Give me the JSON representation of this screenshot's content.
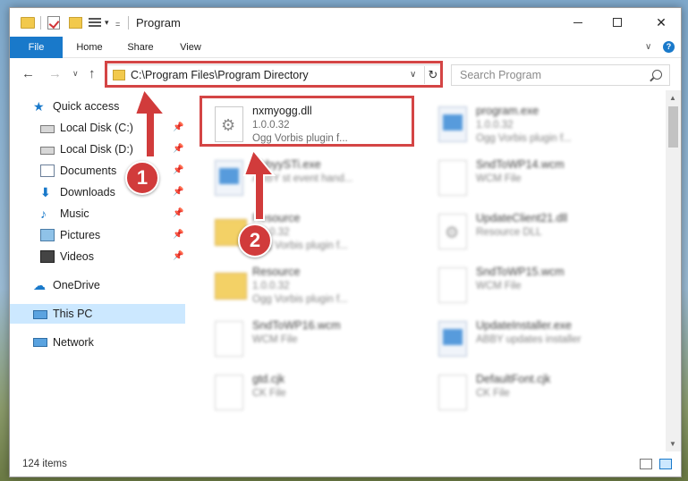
{
  "window": {
    "title": "Program",
    "controls": {
      "minimize": "minimize",
      "maximize": "maximize",
      "close": "✕"
    }
  },
  "ribbon": {
    "tabs": [
      "File",
      "Home",
      "Share",
      "View"
    ],
    "expand": "∨",
    "help": "?"
  },
  "nav": {
    "back": "←",
    "forward": "→",
    "recent": "∨",
    "up": "↑",
    "address": "C:\\Program Files\\Program Directory",
    "address_dropdown": "∨",
    "refresh": "↻",
    "search_placeholder": "Search Program"
  },
  "sidebar": {
    "items": [
      {
        "label": "Quick access",
        "icon": "star-icon",
        "pinned": false
      },
      {
        "label": "Local Disk (C:)",
        "icon": "disk-icon",
        "pinned": true
      },
      {
        "label": "Local Disk (D:)",
        "icon": "disk-icon",
        "pinned": true
      },
      {
        "label": "Documents",
        "icon": "documents-icon",
        "pinned": true
      },
      {
        "label": "Downloads",
        "icon": "download-icon",
        "pinned": true
      },
      {
        "label": "Music",
        "icon": "music-icon",
        "pinned": true
      },
      {
        "label": "Pictures",
        "icon": "pictures-icon",
        "pinned": true
      },
      {
        "label": "Videos",
        "icon": "videos-icon",
        "pinned": true
      },
      {
        "label": "OneDrive",
        "icon": "cloud-icon",
        "pinned": false
      },
      {
        "label": "This PC",
        "icon": "pc-icon",
        "pinned": false,
        "selected": true
      },
      {
        "label": "Network",
        "icon": "network-icon",
        "pinned": false
      }
    ],
    "pin_glyph": "📌"
  },
  "files": [
    {
      "name": "nxmyogg.dll",
      "line2": "1.0.0.32",
      "line3": "Ogg Vorbis plugin f...",
      "icon": "dll",
      "blurred": false
    },
    {
      "name": "program.exe",
      "line2": "1.0.0.32",
      "line3": "Ogg Vorbis plugin f...",
      "icon": "exe",
      "blurred": true
    },
    {
      "name": "AbbyySTi.exe",
      "line2": "ABBY st event hand...",
      "line3": "",
      "icon": "exe",
      "blurred": true
    },
    {
      "name": "SndToWP14.wcm",
      "line2": "WCM File",
      "line3": "",
      "icon": "doc",
      "blurred": true
    },
    {
      "name": "Resource",
      "line2": "1.0.0.32",
      "line3": "Ogg Vorbis plugin f...",
      "icon": "folder",
      "blurred": true
    },
    {
      "name": "UpdateClient21.dll",
      "line2": "Resource DLL",
      "line3": "",
      "icon": "dll",
      "blurred": true
    },
    {
      "name": "Resource",
      "line2": "1.0.0.32",
      "line3": "Ogg Vorbis plugin f...",
      "icon": "folder",
      "blurred": true
    },
    {
      "name": "SndToWP15.wcm",
      "line2": "WCM File",
      "line3": "",
      "icon": "doc",
      "blurred": true
    },
    {
      "name": "SndToWP16.wcm",
      "line2": "WCM File",
      "line3": "",
      "icon": "doc",
      "blurred": true
    },
    {
      "name": "UpdateInstaller.exe",
      "line2": "ABBY updates installer",
      "line3": "",
      "icon": "exe",
      "blurred": true
    },
    {
      "name": "gtd.cjk",
      "line2": "CK File",
      "line3": "",
      "icon": "doc",
      "blurred": true
    },
    {
      "name": "DefaultFont.cjk",
      "line2": "CK File",
      "line3": "",
      "icon": "doc",
      "blurred": true
    }
  ],
  "status": {
    "item_count": "124 items"
  },
  "annotations": {
    "step1": "1",
    "step2": "2",
    "accent": "#d13b3b"
  }
}
